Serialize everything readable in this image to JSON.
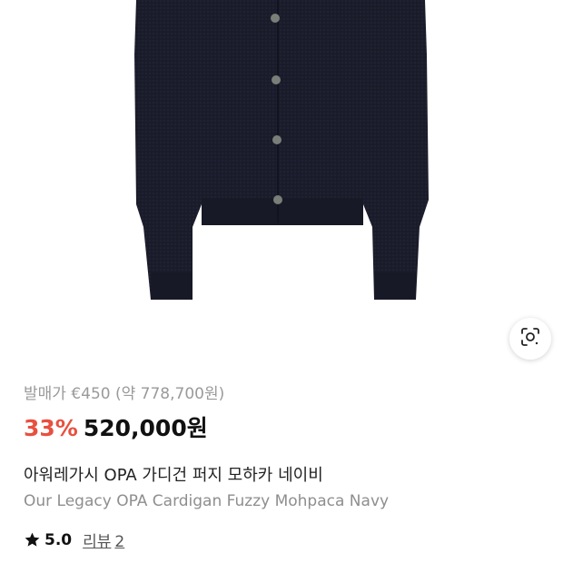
{
  "product": {
    "image_alt": "Our Legacy OPA Cardigan Fuzzy Mohpaca Navy",
    "image_color": "#1b1c2b",
    "button_color": "#7a7e78",
    "lens_icon": "lens-search-icon"
  },
  "pricing": {
    "original_price_text": "발매가 €450 (약 778,700원)",
    "discount": "33%",
    "sale_price": "520,000원",
    "discount_color": "#e8503f"
  },
  "title": {
    "korean": "아워레가시 OPA 가디건 퍼지 모하카 네이비",
    "english": "Our Legacy OPA Cardigan Fuzzy Mohpaca Navy"
  },
  "rating": {
    "icon": "star-icon",
    "value": "5.0",
    "reviews_label": "리뷰",
    "reviews_count": "2"
  }
}
